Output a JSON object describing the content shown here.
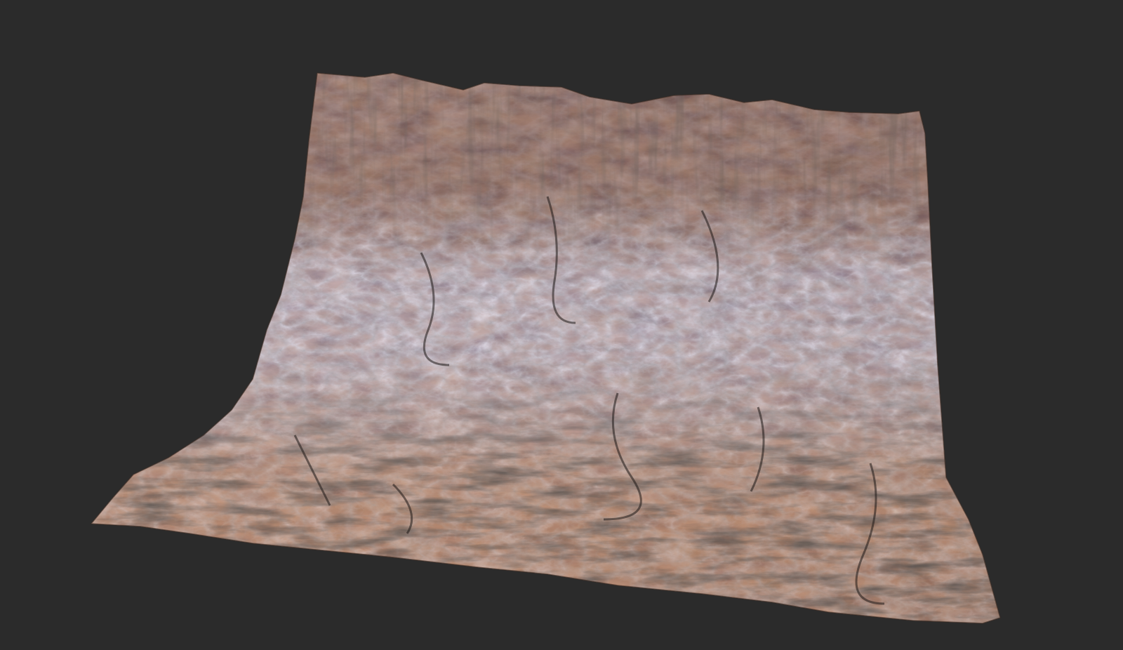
{
  "scene": {
    "background_color": "#2b2b2b",
    "subject": "terrain-mesh",
    "palette": {
      "rock_orange": "#b77a52",
      "rock_dark": "#2e2623",
      "rock_mid": "#6e4a37",
      "stone_blue": "#8d8fa3",
      "stone_light": "#b4b3c2",
      "highlight": "#d9a27a"
    }
  }
}
